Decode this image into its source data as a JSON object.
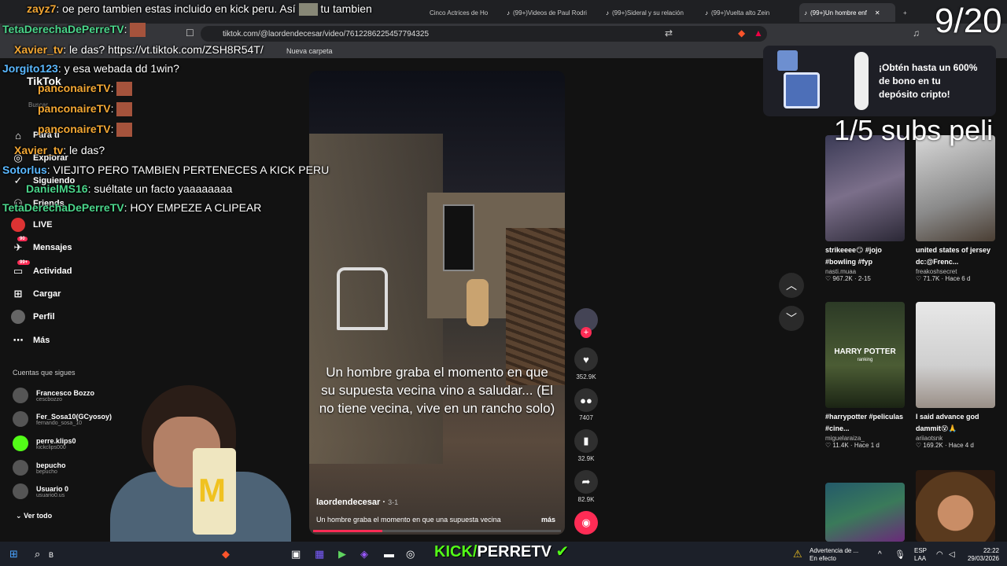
{
  "tabs": [
    {
      "label": "Cinco Actrices de Ho"
    },
    {
      "label": "(99+)Videos de Paul Rodri"
    },
    {
      "label": "(99+)Sideral y su relación"
    },
    {
      "label": "(99+)Vuelta alto Zein"
    },
    {
      "label": "(99+)Un hombre enf"
    }
  ],
  "url": "tiktok.com/@laordendecesar/video/7612286225457794325",
  "bookmark": "Nueva carpeta",
  "sidebar": {
    "logo": "TikTok",
    "search": "Buscar",
    "items": [
      {
        "label": "Para ti",
        "icon": "home-icon"
      },
      {
        "label": "Explorar",
        "icon": "compass-icon"
      },
      {
        "label": "Siguiendo",
        "icon": "following-icon"
      },
      {
        "label": "Friends",
        "icon": "friends-icon"
      },
      {
        "label": "LIVE",
        "icon": "live-icon"
      },
      {
        "label": "Mensajes",
        "icon": "message-icon",
        "badge": "90"
      },
      {
        "label": "Actividad",
        "icon": "activity-icon",
        "badge": "99+"
      },
      {
        "label": "Cargar",
        "icon": "upload-icon"
      },
      {
        "label": "Perfil",
        "icon": "profile-icon"
      },
      {
        "label": "Más",
        "icon": "more-icon"
      }
    ],
    "follow_header": "Cuentas que sigues",
    "following": [
      {
        "name": "Francesco Bozzo",
        "handle": "cescbozzo"
      },
      {
        "name": "Fer_Sosa10(GCyosoy)",
        "handle": "fernando_sosa_10"
      },
      {
        "name": "perre.klips0",
        "handle": "kickclips000"
      },
      {
        "name": "bepucho",
        "handle": "bepucho"
      },
      {
        "name": "Usuario 0",
        "handle": "usuario0.us"
      }
    ],
    "see_all": "Ver todo"
  },
  "video": {
    "caption": "Un hombre graba el momento en que su supuesta vecina vino a saludar... (El no tiene vecina, vive en un rancho solo)",
    "author": "laordendecesar",
    "date": "3-1",
    "description": "Un hombre graba el momento en que una supuesta vecina",
    "more": "más",
    "progress": 0.28
  },
  "actions": {
    "likes": "352.9K",
    "comments": "7407",
    "saves": "32.9K",
    "shares": "82.9K"
  },
  "ad": {
    "text": "¡Obtén hasta un 600% de bono en tu depósito cripto!"
  },
  "overlay": {
    "counter": "9/20",
    "subs": "1/5 subs peli"
  },
  "chat": [
    {
      "user": "zayz7",
      "msg": ": oe pero tambien estas incluido en kick peru. Así",
      "tail": "tu tambien"
    },
    {
      "user": "TetaDerechaDePerreTV",
      "msg": ":"
    },
    {
      "user": "Xavier_tv",
      "msg": ": le das? https://vt.tiktok.com/ZSH8R54T/"
    },
    {
      "user": "Jorgito123",
      "msg": ": y esa webada dd 1win?"
    },
    {
      "user": "panconaireTV",
      "msg": ":"
    },
    {
      "user": "panconaireTV",
      "msg": ":"
    },
    {
      "user": "panconaireTV",
      "msg": ":"
    },
    {
      "user": "Xavier_tv",
      "msg": ": le das?"
    },
    {
      "user": "Sotorlus",
      "msg": ": VIEJITO PERO TAMBIEN PERTENECES A KICK PERU"
    },
    {
      "user": "DanielMS16",
      "msg": ": suéltate un facto yaaaaaaaa"
    },
    {
      "user": "TetaDerechaDePerreTV",
      "msg": ": HOY EMPEZE A CLIPEAR"
    }
  ],
  "cards": [
    {
      "title": "strikeeee😏 #jojo #bowling #fyp",
      "user": "nasti.muaa",
      "meta": "♡ 967.2K · 2-15"
    },
    {
      "title": "united states of jersey dc:@Frenc...",
      "user": "freakoshsecret",
      "meta": "♡ 71.7K · Hace 6 d"
    },
    {
      "title": "#harrypotter #peliculas #cine...",
      "user": "miguelaraiza_",
      "meta": "♡ 11.4K · Hace 1 d"
    },
    {
      "title": "I said advance god dammit😵🙏",
      "user": "ariiaotsnk",
      "meta": "♡ 169.2K · Hace 4 d"
    }
  ],
  "hp_thumb": {
    "title": "HARRY POTTER",
    "sub": "ranking"
  },
  "taskbar": {
    "kick_prefix": "KICK/",
    "kick_name": "PERRETV",
    "warning": "Advertencia de ...",
    "warning_sub": "En efecto",
    "lang": "ESP",
    "lang_sub": "LAA",
    "time": "22:22",
    "date": "29/03/2026",
    "search": "B"
  }
}
